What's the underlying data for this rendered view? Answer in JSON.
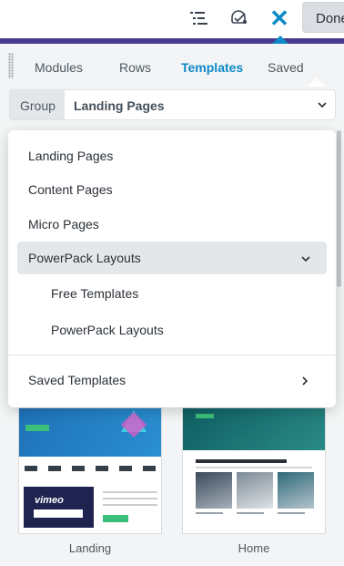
{
  "topbar": {
    "icons": [
      "outline-icon",
      "help-icon",
      "close-icon"
    ],
    "close_glyph": "✕",
    "done_label": "Done",
    "accent_color": "#4a3a8f",
    "active_color": "#0e8ac6"
  },
  "tabs": [
    {
      "label": "Modules",
      "active": false
    },
    {
      "label": "Rows",
      "active": false
    },
    {
      "label": "Templates",
      "active": true
    },
    {
      "label": "Saved",
      "active": false
    }
  ],
  "group": {
    "label": "Group",
    "value": "Landing Pages"
  },
  "dropdown": {
    "items": [
      {
        "label": "Landing Pages"
      },
      {
        "label": "Content Pages"
      },
      {
        "label": "Micro Pages"
      },
      {
        "label": "PowerPack Layouts",
        "expanded": true
      },
      {
        "label": "Free Templates",
        "sub": true
      },
      {
        "label": "PowerPack Layouts",
        "sub": true
      },
      {
        "label": "Saved Templates",
        "has_submenu": true
      }
    ]
  },
  "templates": [
    {
      "caption": "Landing",
      "thumbnail_text": "vimeo"
    },
    {
      "caption": "Home"
    }
  ]
}
